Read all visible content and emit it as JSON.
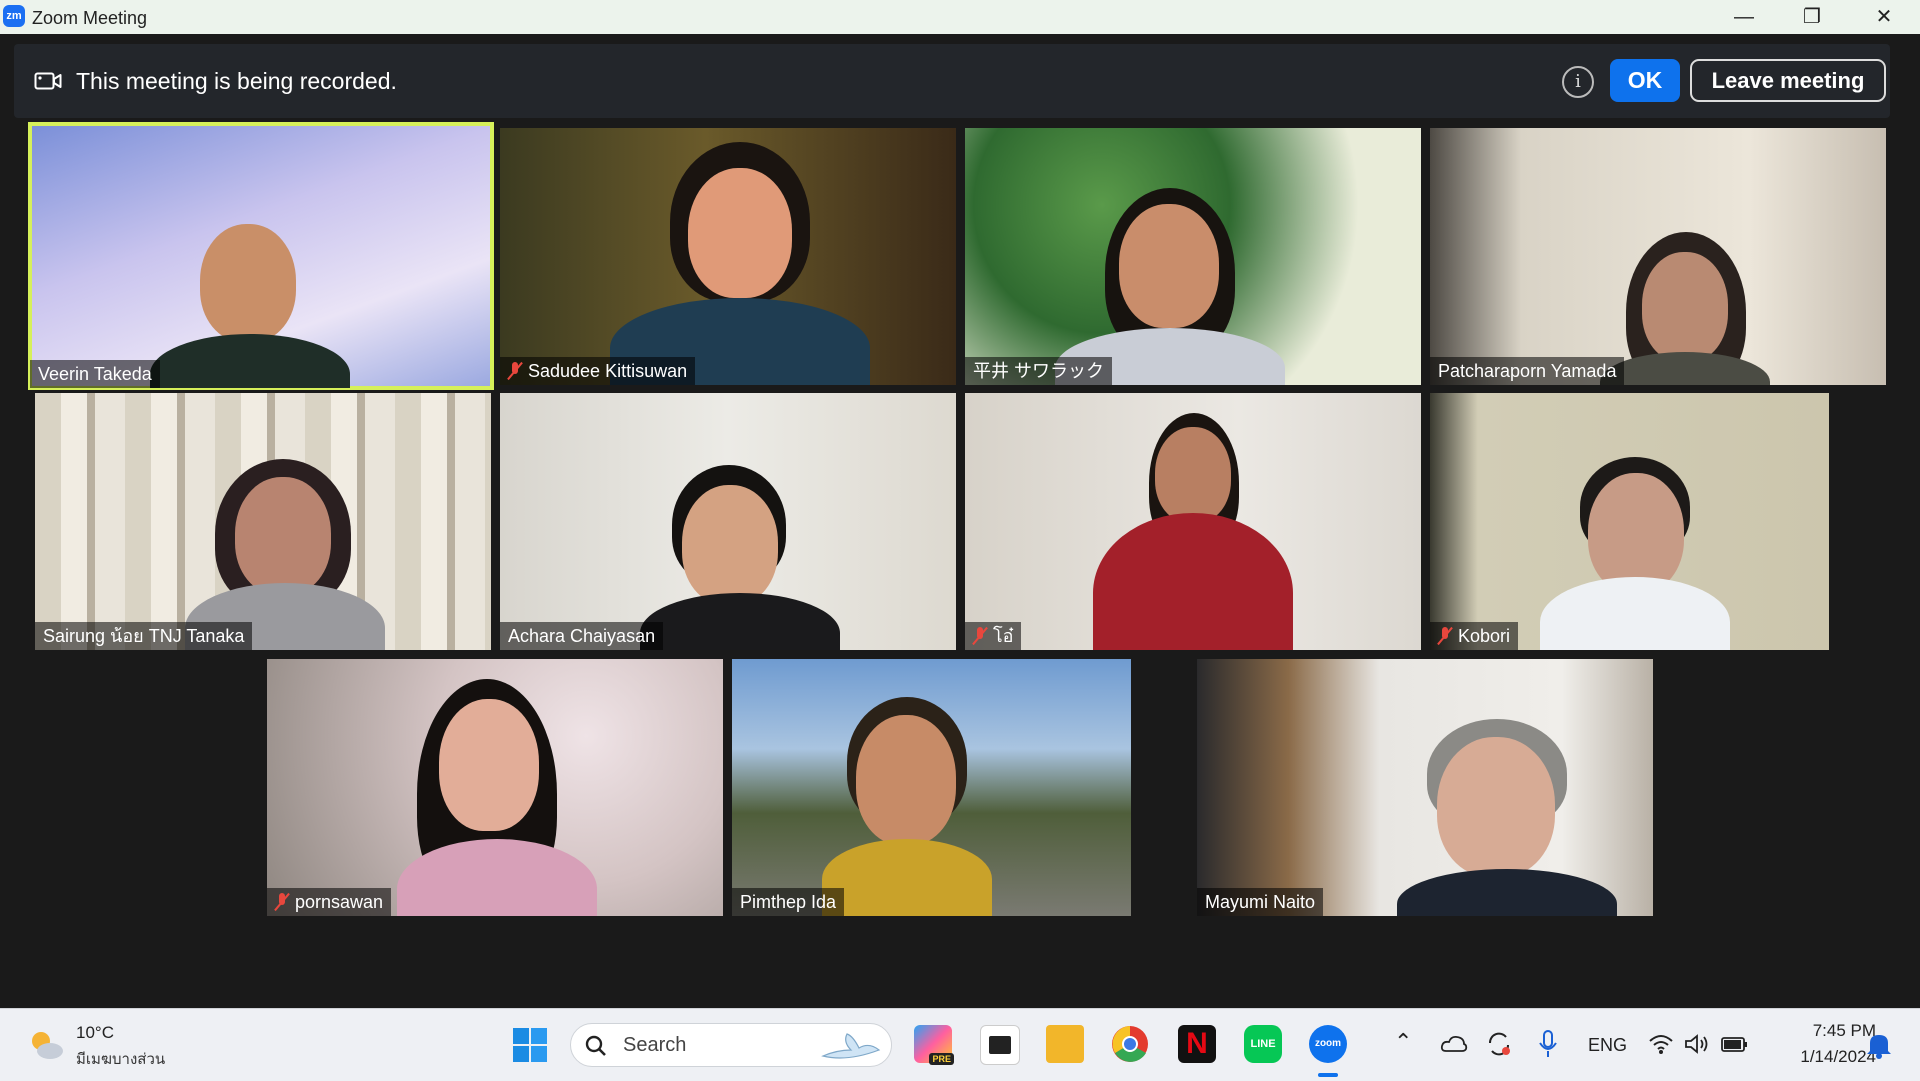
{
  "window": {
    "app_logo": "zm",
    "title": "Zoom Meeting",
    "controls": [
      "minimize-icon",
      "restore-icon",
      "close-icon"
    ]
  },
  "banner": {
    "message": "This meeting is being recorded.",
    "ok_label": "OK",
    "leave_label": "Leave meeting",
    "info_icon": "i"
  },
  "participants": [
    {
      "name": "Veerin Takeda",
      "muted": false,
      "active_speaker": true
    },
    {
      "name": "Sadudee Kittisuwan",
      "muted": true,
      "active_speaker": false
    },
    {
      "name": "平井 サワラック",
      "muted": false,
      "active_speaker": false
    },
    {
      "name": "Patcharaporn Yamada",
      "muted": false,
      "active_speaker": false
    },
    {
      "name": "Sairung น้อย TNJ Tanaka",
      "muted": false,
      "active_speaker": false
    },
    {
      "name": "Achara Chaiyasan",
      "muted": false,
      "active_speaker": false
    },
    {
      "name": "โอ๋",
      "muted": true,
      "active_speaker": false
    },
    {
      "name": "Kobori",
      "muted": true,
      "active_speaker": false
    },
    {
      "name": "pornsawan",
      "muted": true,
      "active_speaker": false
    },
    {
      "name": "Pimthep Ida",
      "muted": false,
      "active_speaker": false
    },
    {
      "name": "Mayumi Naito",
      "muted": false,
      "active_speaker": false
    }
  ],
  "taskbar": {
    "weather_temp": "10°C",
    "weather_desc": "มีเมฆบางส่วน",
    "search_placeholder": "Search",
    "app_badge": "PRE",
    "language": "ENG",
    "time": "7:45 PM",
    "date": "1/14/2024"
  },
  "colors": {
    "accent": "#0e72ed",
    "active_speaker_border": "#d6f05a",
    "muted_icon": "#e8473d"
  }
}
